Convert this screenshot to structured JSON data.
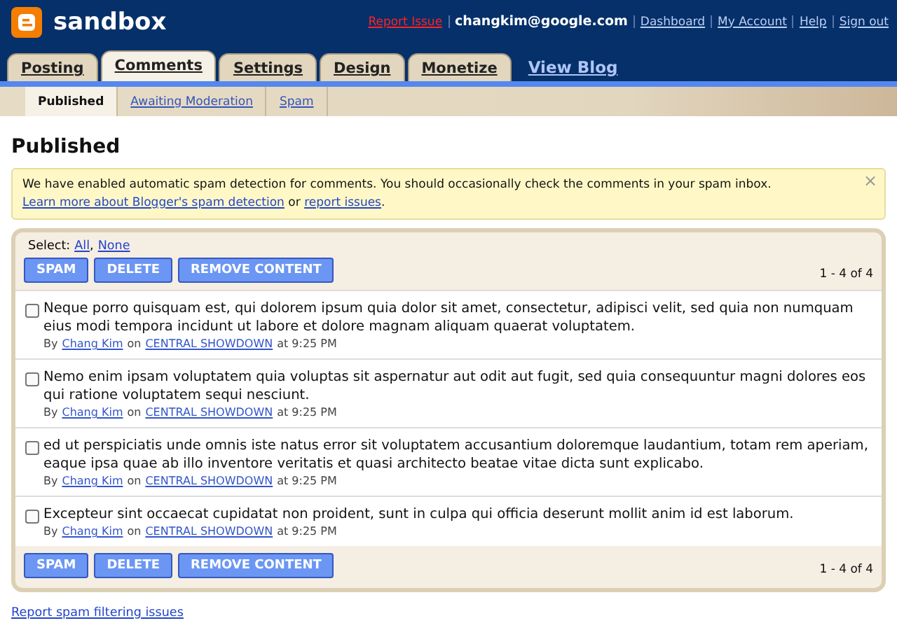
{
  "header": {
    "blog_title": "sandbox",
    "report_issue": "Report Issue",
    "email": "changkim@google.com",
    "links": [
      "Dashboard",
      "My Account",
      "Help",
      "Sign out"
    ]
  },
  "tabs": [
    {
      "label": "Posting",
      "selected": false
    },
    {
      "label": "Comments",
      "selected": true
    },
    {
      "label": "Settings",
      "selected": false
    },
    {
      "label": "Design",
      "selected": false
    },
    {
      "label": "Monetize",
      "selected": false
    }
  ],
  "view_blog": "View Blog",
  "subtabs": [
    {
      "label": "Published",
      "selected": true
    },
    {
      "label": "Awaiting Moderation",
      "selected": false
    },
    {
      "label": "Spam",
      "selected": false
    }
  ],
  "heading": "Published",
  "notice": {
    "text": "We have enabled automatic spam detection for comments. You should occasionally check the comments in your spam inbox.",
    "link": "Learn more about Blogger's spam detection",
    "joiner": "or",
    "link2": "report issues",
    "end": ".",
    "close": "×"
  },
  "select": {
    "label": "Select:",
    "options": [
      "All",
      "None"
    ],
    "separator": ","
  },
  "toolbars": [
    {
      "buttons": [
        "SPAM",
        "DELETE",
        "REMOVE CONTENT"
      ],
      "count": "1 - 4 of 4"
    },
    {
      "buttons": [
        "SPAM",
        "DELETE",
        "REMOVE CONTENT"
      ],
      "count": "1 - 4 of 4"
    }
  ],
  "comments": [
    {
      "text": "Neque porro quisquam est, qui dolorem ipsum quia dolor sit amet, consectetur, adipisci velit, sed quia non numquam eius modi tempora incidunt ut labore et dolore magnam aliquam quaerat voluptatem.",
      "checked": false,
      "by": "By",
      "author": "Chang Kim",
      "on": "on",
      "post": "CENTRAL SHOWDOWN",
      "time": "at 9:25 PM"
    },
    {
      "text": "Nemo enim ipsam voluptatem quia voluptas sit aspernatur aut odit aut fugit, sed quia consequuntur magni dolores eos qui ratione voluptatem sequi nesciunt.",
      "checked": false,
      "by": "By",
      "author": "Chang Kim",
      "on": "on",
      "post": "CENTRAL SHOWDOWN",
      "time": "at 9:25 PM"
    },
    {
      "text": "ed ut perspiciatis unde omnis iste natus error sit voluptatem accusantium doloremque laudantium, totam rem aperiam, eaque ipsa quae ab illo inventore veritatis et quasi architecto beatae vitae dicta sunt explicabo.",
      "checked": false,
      "by": "By",
      "author": "Chang Kim",
      "on": "on",
      "post": "CENTRAL SHOWDOWN",
      "time": "at 9:25 PM"
    },
    {
      "text": "Excepteur sint occaecat cupidatat non proident, sunt in culpa qui officia deserunt mollit anim id est laborum.",
      "checked": false,
      "by": "By",
      "author": "Chang Kim",
      "on": "on",
      "post": "CENTRAL SHOWDOWN",
      "time": "at 9:25 PM"
    }
  ],
  "footer_link": "Report spam filtering issues"
}
